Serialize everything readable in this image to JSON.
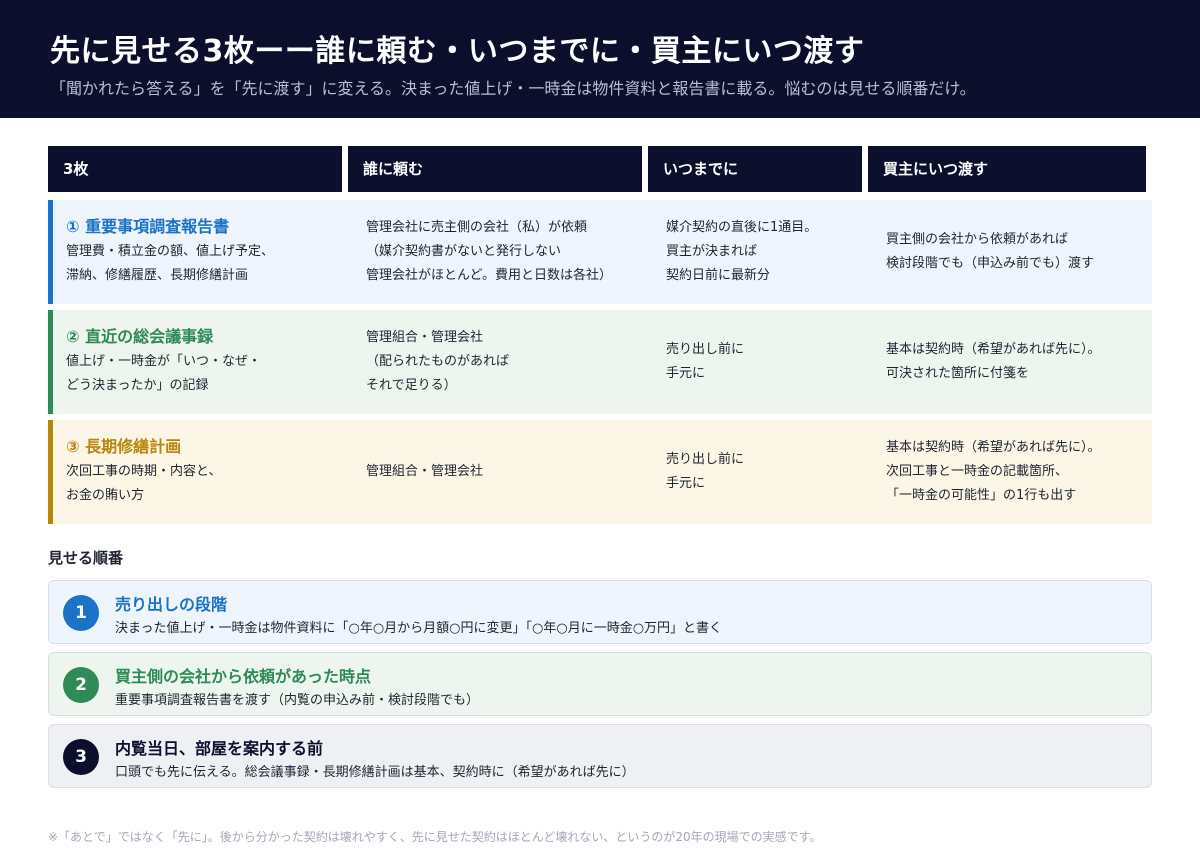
{
  "header": {
    "title": "先に見せる3枚ーー誰に頼む・いつまでに・買主にいつ渡す",
    "subtitle": "「聞かれたら答える」を「先に渡す」に変える。決まった値上げ・一時金は物件資料と報告書に載る。悩むのは見せる順番だけ。"
  },
  "table": {
    "headers": [
      "3枚",
      "誰に頼む",
      "いつまでに",
      "買主にいつ渡す"
    ],
    "rows": [
      {
        "title": "① 重要事項調査報告書",
        "desc": [
          "管理費・積立金の額、値上げ予定、",
          "滞納、修繕履歴、長期修繕計画"
        ],
        "who": [
          "管理会社に売主側の会社（私）が依頼",
          "（媒介契約書がないと発行しない",
          "管理会社がほとんど。費用と日数は各社）"
        ],
        "when": [
          "媒介契約の直後に1通目。",
          "買主が決まれば",
          "契約日前に最新分"
        ],
        "give": [
          "買主側の会社から依頼があれば",
          "検討段階でも（申込み前でも）渡す"
        ]
      },
      {
        "title": "② 直近の総会議事録",
        "desc": [
          "値上げ・一時金が「いつ・なぜ・",
          "どう決まったか」の記録"
        ],
        "who": [
          "管理組合・管理会社",
          "（配られたものがあれば",
          "それで足りる）"
        ],
        "when": [
          "売り出し前に",
          "手元に"
        ],
        "give": [
          "基本は契約時（希望があれば先に）。",
          "可決された箇所に付箋を"
        ]
      },
      {
        "title": "③ 長期修繕計画",
        "desc": [
          "次回工事の時期・内容と、",
          "お金の賄い方"
        ],
        "who": [
          "管理組合・管理会社"
        ],
        "when": [
          "売り出し前に",
          "手元に"
        ],
        "give": [
          "基本は契約時（希望があれば先に）。",
          "次回工事と一時金の記載箇所、",
          "「一時金の可能性」の1行も出す"
        ]
      }
    ]
  },
  "order": {
    "title": "見せる順番",
    "steps": [
      {
        "num": "1",
        "title": "売り出しの段階",
        "desc": "決まった値上げ・一時金は物件資料に「○年○月から月額○円に変更」「○年○月に一時金○万円」と書く"
      },
      {
        "num": "2",
        "title": "買主側の会社から依頼があった時点",
        "desc": "重要事項調査報告書を渡す（内覧の申込み前・検討段階でも）"
      },
      {
        "num": "3",
        "title": "内覧当日、部屋を案内する前",
        "desc": "口頭でも先に伝える。総会議事録・長期修繕計画は基本、契約時に（希望があれば先に）"
      }
    ]
  },
  "footnote": "※「あとで」ではなく「先に」。後から分かった契約は壊れやすく、先に見せた契約はほとんど壊れない、というのが20年の現場での実感です。",
  "colors": {
    "navy": "#0b0f2c",
    "blue": "#1a73c9",
    "green": "#2e8b57",
    "gold": "#b8860b",
    "dark": "#0b0f2c",
    "row1_bg": "#eef5fc",
    "row2_bg": "#eef5ee",
    "row3_bg": "#fbf6e6",
    "step3_bg": "#eef0f4"
  }
}
